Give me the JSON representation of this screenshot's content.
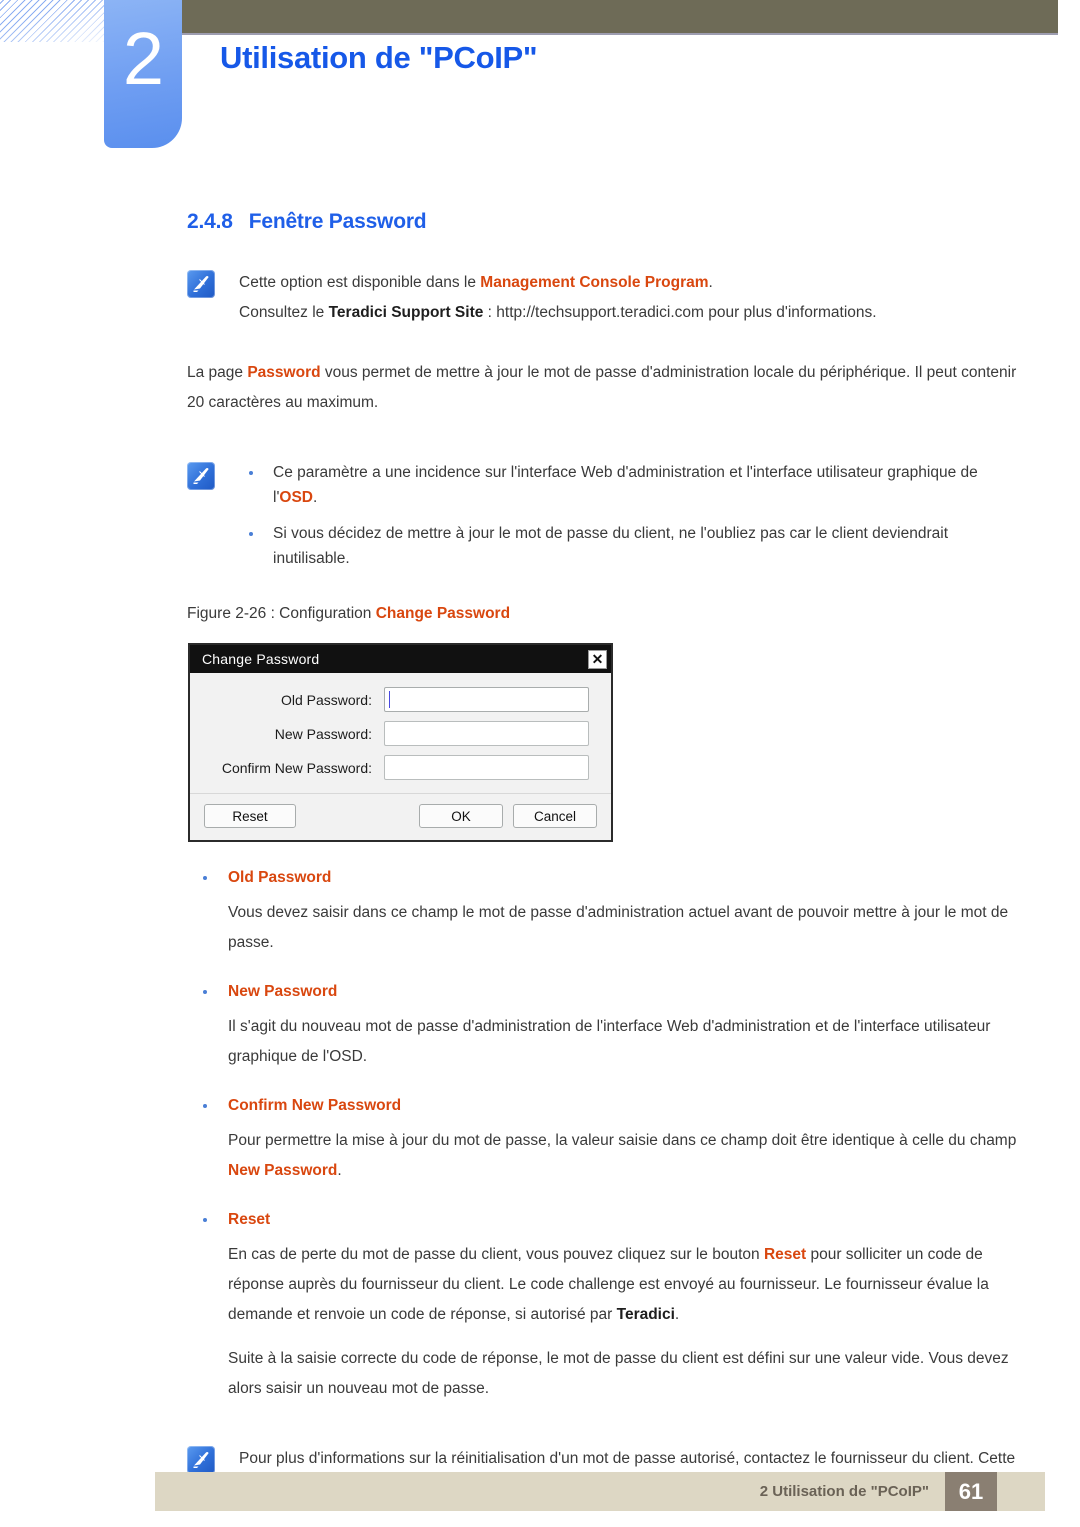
{
  "header": {
    "chapter_number": "2",
    "chapter_title": "Utilisation de \"PCoIP\""
  },
  "section": {
    "number": "2.4.8",
    "title": "Fenêtre Password"
  },
  "note_top": {
    "icon": "note-pen-icon",
    "line1_prefix": "Cette option est disponible dans le ",
    "line1_accent": "Management Console Program",
    "line1_suffix": ".",
    "line2_prefix": "Consultez le ",
    "line2_strong": "Teradici Support Site",
    "line2_suffix": " : http://techsupport.teradici.com pour plus d'informations."
  },
  "intro": {
    "prefix": "La page ",
    "accent": "Password",
    "suffix": " vous permet de mettre à jour le mot de passe d'administration locale du périphérique. Il peut contenir 20 caractères au maximum."
  },
  "note_mid": {
    "icon": "note-pen-icon",
    "items": [
      {
        "prefix": "Ce paramètre a une incidence sur l'interface Web d'administration et l'interface utilisateur graphique de l'",
        "accent": "OSD",
        "suffix": "."
      },
      {
        "prefix": "Si vous décidez de mettre à jour le mot de passe du client, ne l'oubliez pas car le client deviendrait inutilisable.",
        "accent": "",
        "suffix": ""
      }
    ]
  },
  "figure": {
    "caption_prefix": "Figure 2-26 : Configuration ",
    "caption_accent": "Change Password",
    "dialog": {
      "title": "Change Password",
      "close_icon": "close-icon",
      "close_label": "✕",
      "fields": [
        {
          "label": "Old Password:",
          "value": "",
          "focused": true
        },
        {
          "label": "New Password:",
          "value": "",
          "focused": false
        },
        {
          "label": "Confirm New Password:",
          "value": "",
          "focused": false
        }
      ],
      "buttons": {
        "reset": "Reset",
        "ok": "OK",
        "cancel": "Cancel"
      }
    }
  },
  "definitions": [
    {
      "term": "Old Password",
      "paragraphs": [
        {
          "text": "Vous devez saisir dans ce champ le mot de passe d'administration actuel avant de pouvoir mettre à jour le mot de passe."
        }
      ]
    },
    {
      "term": "New Password",
      "paragraphs": [
        {
          "text": "Il s'agit du nouveau mot de passe d'administration de l'interface Web d'administration et de l'interface utilisateur graphique de l'OSD."
        }
      ]
    },
    {
      "term": "Confirm New Password",
      "paragraphs": [
        {
          "prefix": "Pour permettre la mise à jour du mot de passe, la valeur saisie dans ce champ doit être identique à celle du champ ",
          "accent": "New Password",
          "suffix": "."
        }
      ]
    },
    {
      "term": "Reset",
      "paragraphs": [
        {
          "prefix": "En cas de perte du mot de passe du client, vous pouvez cliquez sur le bouton ",
          "accent": "Reset",
          "mid": " pour solliciter un code de réponse auprès du fournisseur du client. Le code challenge est envoyé au fournisseur. Le fournisseur évalue la demande et renvoie un code de réponse, si autorisé par ",
          "strong": "Teradici",
          "suffix": "."
        },
        {
          "text": "Suite à la saisie correcte du code de réponse, le mot de passe du client est défini sur une valeur vide. Vous devez alors saisir un nouveau mot de passe."
        }
      ]
    }
  ],
  "note_bottom": {
    "icon": "note-pen-icon",
    "text": "Pour plus d'informations sur la réinitialisation d'un mot de passe autorisé, contactez le fournisseur du client. Cette option n'est pas disponible dans l'interface Web d'administration, mais uniquement via l'OSD."
  },
  "footer": {
    "text": "2 Utilisation de \"PCoIP\"",
    "page_number": "61"
  },
  "colors": {
    "accent_orange": "#d9470f",
    "heading_blue": "#1f5fe8",
    "title_blue": "#1658e8",
    "olive": "#6e6b57",
    "footer_bar": "#ddd7c4",
    "footer_page_box": "#8a7f72"
  }
}
